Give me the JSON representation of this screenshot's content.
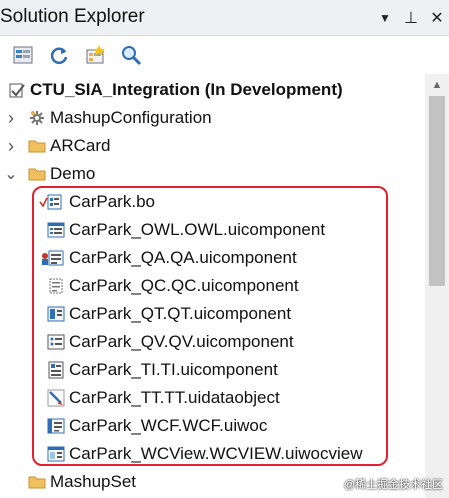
{
  "panel": {
    "title": "Solution Explorer",
    "dropdown_glyph": "▼",
    "pin_glyph": "⊥",
    "close_glyph": "✕"
  },
  "toolbar": {
    "buttons": [
      "properties-icon",
      "refresh-icon",
      "show-all-files-icon",
      "search-icon"
    ]
  },
  "tree": {
    "root": {
      "label": "CTU_SIA_Integration (In Development)",
      "icon": "solution-icon"
    },
    "items": [
      {
        "label": "MashupConfiguration",
        "icon": "config-icon",
        "expander": "›"
      },
      {
        "label": "ARCard",
        "icon": "folder-icon",
        "expander": "›"
      },
      {
        "label": "Demo",
        "icon": "folder-icon",
        "expander": "⌄"
      },
      {
        "label": "CarPark.bo",
        "icon": "business-object-icon"
      },
      {
        "label": "CarPark_OWL.OWL.uicomponent",
        "icon": "object-worklist-icon"
      },
      {
        "label": "CarPark_QA.QA.uicomponent",
        "icon": "quick-activity-icon"
      },
      {
        "label": "CarPark_QC.QC.uicomponent",
        "icon": "quick-create-icon"
      },
      {
        "label": "CarPark_QT.QT.uicomponent",
        "icon": "quick-view-icon"
      },
      {
        "label": "CarPark_QV.QV.uicomponent",
        "icon": "quick-view-form-icon"
      },
      {
        "label": "CarPark_TI.TI.uicomponent",
        "icon": "thing-inspector-icon"
      },
      {
        "label": "CarPark_TT.TT.uidataobject",
        "icon": "data-object-icon"
      },
      {
        "label": "CarPark_WCF.WCF.uiwoc",
        "icon": "work-center-icon"
      },
      {
        "label": "CarPark_WCView.WCVIEW.uiwocview",
        "icon": "work-center-view-icon"
      },
      {
        "label": "MashupSet",
        "icon": "folder-icon"
      }
    ]
  },
  "watermark": "@稀土掘金技术社区",
  "colors": {
    "highlight": "#e2202f",
    "folder": "#e8b04b",
    "accent_blue": "#2f6db5"
  }
}
